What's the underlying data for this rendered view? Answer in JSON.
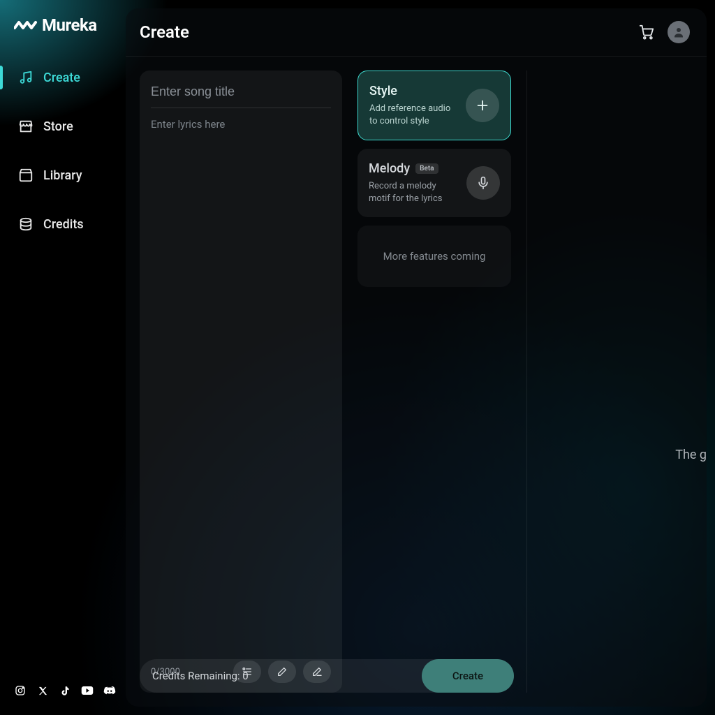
{
  "brand": {
    "name": "Mureka"
  },
  "sidebar": {
    "items": [
      {
        "label": "Create",
        "active": true
      },
      {
        "label": "Store"
      },
      {
        "label": "Library"
      },
      {
        "label": "Credits"
      }
    ]
  },
  "header": {
    "title": "Create"
  },
  "editor": {
    "title_placeholder": "Enter song title",
    "lyrics_placeholder": "Enter lyrics here",
    "char_count": "0/3000"
  },
  "cards": {
    "style": {
      "title": "Style",
      "subtitle": "Add reference audio to control style"
    },
    "melody": {
      "title": "Melody",
      "badge": "Beta",
      "subtitle": "Record a melody motif for the lyrics"
    },
    "coming": {
      "label": "More features coming"
    }
  },
  "footer_bar": {
    "credits_label": "Credits Remaining: 0",
    "create_label": "Create"
  },
  "right_panel": {
    "teaser": "The g"
  },
  "colors": {
    "accent": "#3ddad7"
  }
}
